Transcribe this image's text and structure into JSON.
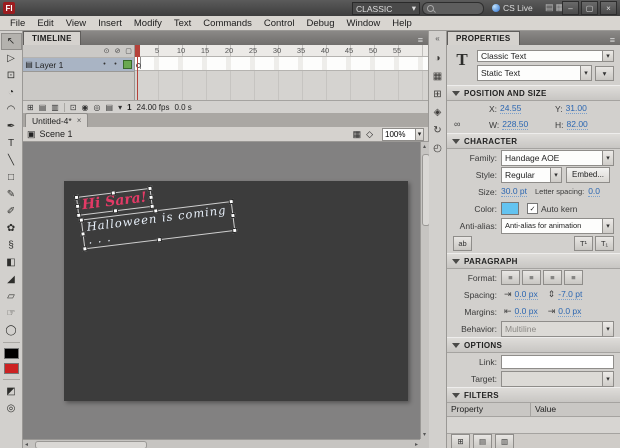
{
  "app_bar": {
    "logo": "Fl",
    "workspace": "CLASSIC",
    "cs_live": "CS Live",
    "search_value": ""
  },
  "menu_bar": {
    "items": [
      "File",
      "Edit",
      "View",
      "Insert",
      "Modify",
      "Text",
      "Commands",
      "Control",
      "Debug",
      "Window",
      "Help"
    ]
  },
  "toolbox": {
    "tools": [
      {
        "name": "selection",
        "glyph": "↖"
      },
      {
        "name": "subselection",
        "glyph": "▷"
      },
      {
        "name": "free-transform",
        "glyph": "⊡"
      },
      {
        "name": "3d-rotation",
        "glyph": "◔"
      },
      {
        "name": "lasso",
        "glyph": "◠"
      },
      {
        "name": "pen",
        "glyph": "✒"
      },
      {
        "name": "text",
        "glyph": "T"
      },
      {
        "name": "line",
        "glyph": "╲"
      },
      {
        "name": "rectangle",
        "glyph": "□"
      },
      {
        "name": "pencil",
        "glyph": "✎"
      },
      {
        "name": "brush",
        "glyph": "✐"
      },
      {
        "name": "deco",
        "glyph": "✿"
      },
      {
        "name": "bone",
        "glyph": "§"
      },
      {
        "name": "paint-bucket",
        "glyph": "◧"
      },
      {
        "name": "eyedropper",
        "glyph": "◢"
      },
      {
        "name": "eraser",
        "glyph": "▱"
      },
      {
        "name": "hand",
        "glyph": "☞"
      },
      {
        "name": "zoom",
        "glyph": "◯"
      }
    ],
    "stroke_color": "#000000",
    "fill_color": "#cc2222"
  },
  "timeline": {
    "tab": "TIMELINE",
    "layer_name": "Layer 1",
    "ruler": [
      "5",
      "10",
      "15",
      "20",
      "25",
      "30",
      "35",
      "40",
      "45",
      "50",
      "55"
    ],
    "current_frame": "1",
    "frame_rate": "24.00 fps",
    "elapsed_time": "0.0 s"
  },
  "document": {
    "tab_title": "Untitled-4*",
    "scene": "Scene 1",
    "zoom": "100%"
  },
  "stage": {
    "line1": "Hi Sara!",
    "line2": "Halloween is coming . . .",
    "line1_color": "#e23a66",
    "line2_color": "#e8f0fa"
  },
  "dock": {
    "icons": [
      {
        "name": "color",
        "glyph": "◑"
      },
      {
        "name": "swatches",
        "glyph": "▦"
      },
      {
        "name": "align",
        "glyph": "⊞"
      },
      {
        "name": "info",
        "glyph": "◈"
      },
      {
        "name": "transform",
        "glyph": "↻"
      },
      {
        "name": "history",
        "glyph": "◴"
      }
    ]
  },
  "icons": {
    "panel_menu": "≡",
    "collapse_dock": "«",
    "minimize": "–",
    "maximize": "▢",
    "close_window": "×",
    "close_tab": "×",
    "workspace_doc1": "▤",
    "workspace_doc2": "▦",
    "eye": "⊙",
    "lock": "⊘",
    "outline_box": "▢",
    "layer_page": "▤",
    "new_layer": "⊞",
    "new_folder": "▤",
    "delete_layer": "▥",
    "center_frame": "⊡",
    "onion_skin": "◉",
    "onion_outlines": "◎",
    "edit_multiple_frames": "▤",
    "modify_markers": "▾",
    "scene": "▣",
    "edit_scene": "▦",
    "edit_symbol": "◇",
    "zoom_arrow": "▾",
    "big_t": "T",
    "orientation": "▾",
    "chain": "∞",
    "selectable": "ab",
    "superscript": "T¹",
    "subscript": "T₁",
    "align_left": "≡",
    "align_center": "≡",
    "align_right": "≡",
    "align_justify": "≡",
    "indent": "⇥",
    "line_spacing": "⇕",
    "margin_left": "⇤",
    "margin_right": "⇥",
    "add_filter": "⊞",
    "filter_presets": "▤",
    "delete_filter": "▥",
    "scroll_up": "▴",
    "scroll_down": "▾",
    "scroll_left": "◂",
    "scroll_right": "▸",
    "layer_dot": "•"
  },
  "properties": {
    "tab": "PROPERTIES",
    "instance_type": "Classic Text",
    "text_type": "Static Text",
    "position_size": {
      "title": "POSITION AND SIZE",
      "x_label": "X:",
      "x": "24.55",
      "y_label": "Y:",
      "y": "31.00",
      "w_label": "W:",
      "w": "228.50",
      "h_label": "H:",
      "h": "82.00"
    },
    "character": {
      "title": "CHARACTER",
      "family_label": "Family:",
      "family": "Handage AOE",
      "style_label": "Style:",
      "style": "Regular",
      "embed_button": "Embed...",
      "size_label": "Size:",
      "size": "30.0 pt",
      "letter_spacing_label": "Letter spacing:",
      "letter_spacing": "0.0",
      "color_label": "Color:",
      "color_value": "#63c3f0",
      "auto_kern": "Auto kern",
      "anti_alias_label": "Anti-alias:",
      "anti_alias": "Anti-alias for animation"
    },
    "paragraph": {
      "title": "PARAGRAPH",
      "format_label": "Format:",
      "spacing_label": "Spacing:",
      "indent": "0.0 px",
      "line_spacing": "-7.0 pt",
      "margins_label": "Margins:",
      "margin_left": "0.0 px",
      "margin_right": "0.0 px",
      "behavior_label": "Behavior:",
      "behavior": "Multiline"
    },
    "options": {
      "title": "OPTIONS",
      "link_label": "Link:",
      "link_value": "",
      "target_label": "Target:",
      "target_value": ""
    },
    "filters": {
      "title": "FILTERS",
      "col_property": "Property",
      "col_value": "Value"
    }
  }
}
